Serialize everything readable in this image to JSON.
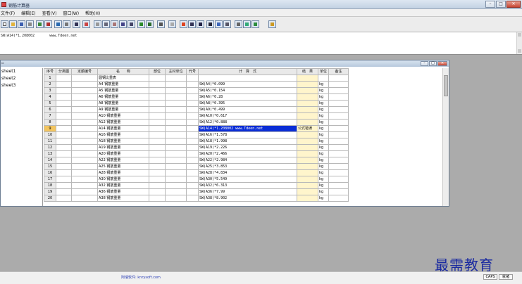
{
  "window": {
    "title": "钢筋计算器"
  },
  "menu": [
    "文件(F)",
    "编辑(E)",
    "查看(V)",
    "窗口(W)",
    "帮助(H)"
  ],
  "formula": {
    "text": "SW(A14)*1.208002       www.Tdeen.net"
  },
  "sheets": [
    "sheet1",
    "sheet2",
    "sheet3"
  ],
  "table": {
    "headers": [
      "序号",
      "分类图",
      "定额编号",
      "名　　称",
      "部位",
      "主材单位",
      "代号",
      "计　算　式",
      "结　果",
      "单位",
      "备注"
    ],
    "rows": [
      {
        "num": "1",
        "name": "圆钢比重表",
        "calc": "",
        "result": "",
        "unit": ""
      },
      {
        "num": "2",
        "name": "A4 钢筋重量",
        "calc": "SW(A4)*0.099",
        "result": "",
        "unit": "kg"
      },
      {
        "num": "3",
        "name": "A5 钢筋重量",
        "calc": "SW(A5)*0.154",
        "result": "",
        "unit": "kg"
      },
      {
        "num": "4",
        "name": "A6 钢筋重量",
        "calc": "SW(A6)*0.28",
        "result": "",
        "unit": "kg"
      },
      {
        "num": "5",
        "name": "A8 钢筋重量",
        "calc": "SW(A8)*0.395",
        "result": "",
        "unit": "kg"
      },
      {
        "num": "6",
        "name": "A9 钢筋重量",
        "calc": "SW(A9)*0.499",
        "result": "",
        "unit": "kg"
      },
      {
        "num": "7",
        "name": "A10 钢筋重量",
        "calc": "SW(A10)*0.617",
        "result": "",
        "unit": "kg"
      },
      {
        "num": "8",
        "name": "A12 钢筋重量",
        "calc": "SW(A12)*0.888",
        "result": "",
        "unit": "kg"
      },
      {
        "num": "9",
        "name": "A14 钢筋重量",
        "calc": "SW(A14)*1.208002     www.Tdeen.net",
        "result": "公式错误",
        "unit": "kg",
        "selected": true
      },
      {
        "num": "10",
        "name": "A16 钢筋重量",
        "calc": "SW(A16)*1.578",
        "result": "",
        "unit": "kg"
      },
      {
        "num": "11",
        "name": "A18 钢筋重量",
        "calc": "SW(A18)*1.998",
        "result": "",
        "unit": "kg"
      },
      {
        "num": "12",
        "name": "A19 钢筋重量",
        "calc": "SW(A19)*2.226",
        "result": "",
        "unit": "kg"
      },
      {
        "num": "13",
        "name": "A20 钢筋重量",
        "calc": "SW(A20)*2.466",
        "result": "",
        "unit": "kg"
      },
      {
        "num": "14",
        "name": "A22 钢筋重量",
        "calc": "SW(A22)*2.984",
        "result": "",
        "unit": "kg"
      },
      {
        "num": "15",
        "name": "A25 钢筋重量",
        "calc": "SW(A25)*3.853",
        "result": "",
        "unit": "kg"
      },
      {
        "num": "16",
        "name": "A28 钢筋重量",
        "calc": "SW(A28)*4.834",
        "result": "",
        "unit": "kg"
      },
      {
        "num": "17",
        "name": "A30 钢筋重量",
        "calc": "SW(A30)*5.549",
        "result": "",
        "unit": "kg"
      },
      {
        "num": "18",
        "name": "A32 钢筋重量",
        "calc": "SW(A32)*6.313",
        "result": "",
        "unit": "kg"
      },
      {
        "num": "19",
        "name": "A36 钢筋重量",
        "calc": "SW(A36)*7.99",
        "result": "",
        "unit": "kg"
      },
      {
        "num": "20",
        "name": "A38 钢筋重量",
        "calc": "SW(A38)*8.902",
        "result": "",
        "unit": "kg"
      }
    ]
  },
  "status": {
    "text": "阿瑞软件: knrysoft.com",
    "cell1": "CAPS",
    "cell2": "就绪"
  },
  "watermark": "最需教育",
  "colors": {
    "selection": "#0a2dd6",
    "result_column": "#fff5cc",
    "selected_row_header": "#f3c560"
  }
}
